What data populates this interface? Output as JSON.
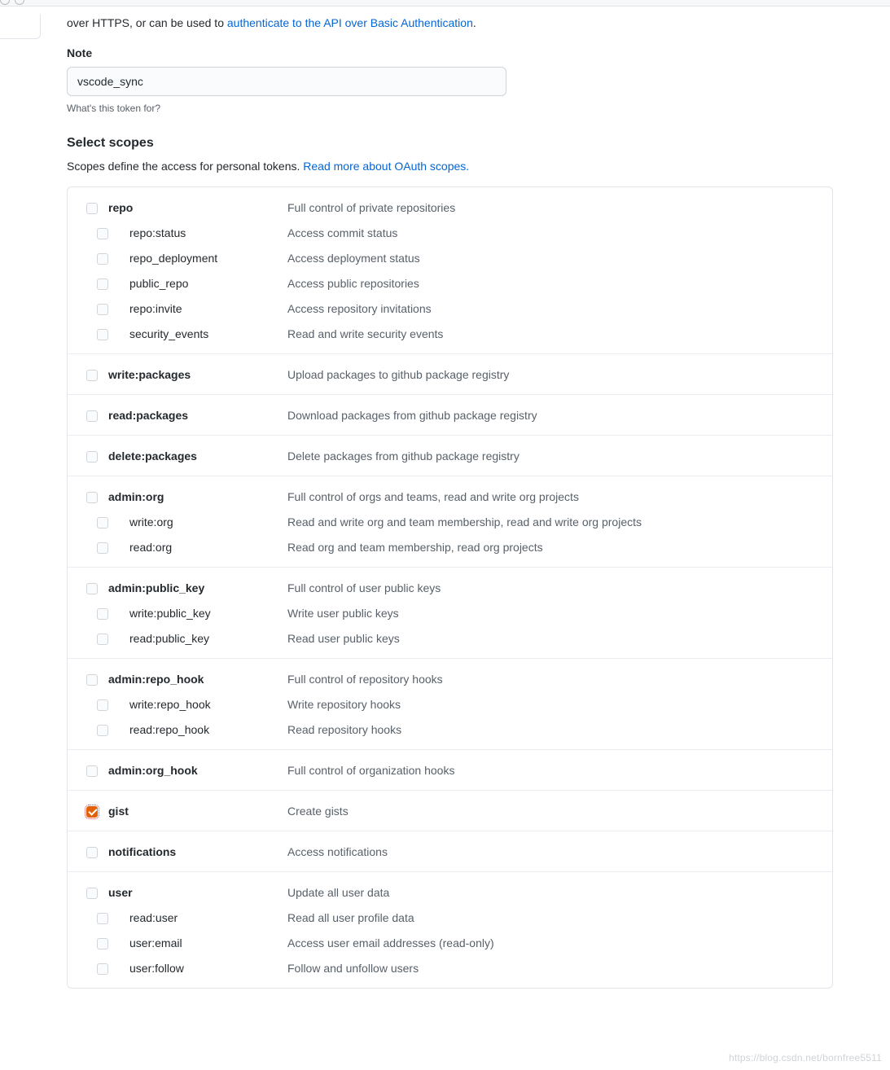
{
  "intro_prefix": "over HTTPS, or can be used to ",
  "intro_link": "authenticate to the API over Basic Authentication",
  "intro_suffix": ".",
  "note_label": "Note",
  "note_value": "vscode_sync",
  "note_help": "What's this token for?",
  "scopes_heading": "Select scopes",
  "scopes_desc_prefix": "Scopes define the access for personal tokens. ",
  "scopes_link": "Read more about OAuth scopes.",
  "groups": [
    {
      "parent": {
        "name": "repo",
        "desc": "Full control of private repositories",
        "checked": false
      },
      "children": [
        {
          "name": "repo:status",
          "desc": "Access commit status"
        },
        {
          "name": "repo_deployment",
          "desc": "Access deployment status"
        },
        {
          "name": "public_repo",
          "desc": "Access public repositories"
        },
        {
          "name": "repo:invite",
          "desc": "Access repository invitations"
        },
        {
          "name": "security_events",
          "desc": "Read and write security events"
        }
      ]
    },
    {
      "parent": {
        "name": "write:packages",
        "desc": "Upload packages to github package registry"
      },
      "children": []
    },
    {
      "parent": {
        "name": "read:packages",
        "desc": "Download packages from github package registry"
      },
      "children": []
    },
    {
      "parent": {
        "name": "delete:packages",
        "desc": "Delete packages from github package registry"
      },
      "children": []
    },
    {
      "parent": {
        "name": "admin:org",
        "desc": "Full control of orgs and teams, read and write org projects"
      },
      "children": [
        {
          "name": "write:org",
          "desc": "Read and write org and team membership, read and write org projects"
        },
        {
          "name": "read:org",
          "desc": "Read org and team membership, read org projects"
        }
      ]
    },
    {
      "parent": {
        "name": "admin:public_key",
        "desc": "Full control of user public keys"
      },
      "children": [
        {
          "name": "write:public_key",
          "desc": "Write user public keys"
        },
        {
          "name": "read:public_key",
          "desc": "Read user public keys"
        }
      ]
    },
    {
      "parent": {
        "name": "admin:repo_hook",
        "desc": "Full control of repository hooks"
      },
      "children": [
        {
          "name": "write:repo_hook",
          "desc": "Write repository hooks"
        },
        {
          "name": "read:repo_hook",
          "desc": "Read repository hooks"
        }
      ]
    },
    {
      "parent": {
        "name": "admin:org_hook",
        "desc": "Full control of organization hooks"
      },
      "children": []
    },
    {
      "parent": {
        "name": "gist",
        "desc": "Create gists",
        "checked": true,
        "focused": true
      },
      "children": []
    },
    {
      "parent": {
        "name": "notifications",
        "desc": "Access notifications"
      },
      "children": []
    },
    {
      "parent": {
        "name": "user",
        "desc": "Update all user data"
      },
      "children": [
        {
          "name": "read:user",
          "desc": "Read all user profile data"
        },
        {
          "name": "user:email",
          "desc": "Access user email addresses (read-only)"
        },
        {
          "name": "user:follow",
          "desc": "Follow and unfollow users"
        }
      ]
    }
  ],
  "watermark": "https://blog.csdn.net/bornfree5511"
}
